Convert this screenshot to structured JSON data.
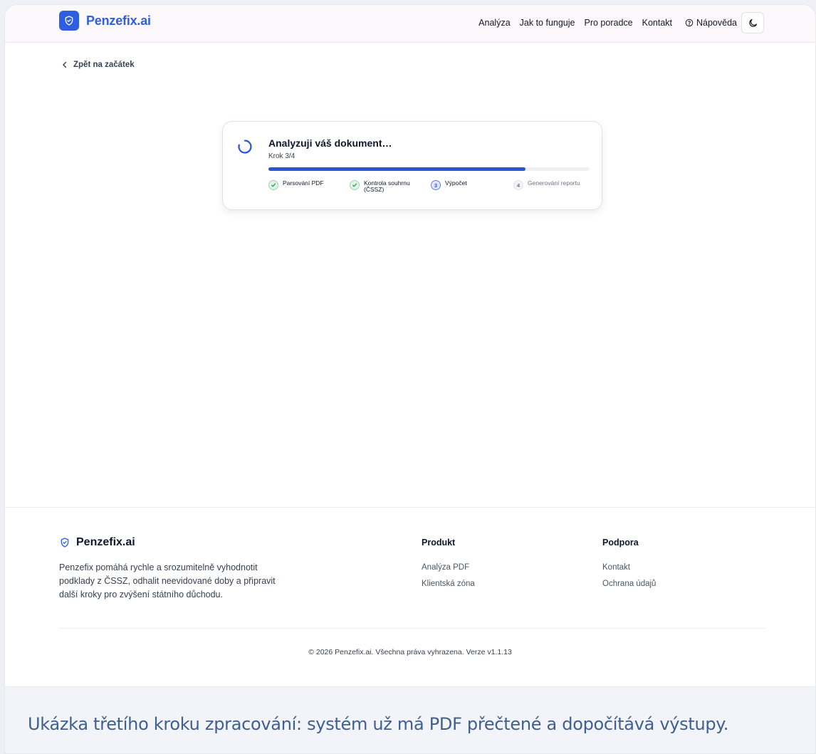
{
  "header": {
    "brand": "Penzefix.ai",
    "nav": [
      "Analýza",
      "Jak to funguje",
      "Pro poradce",
      "Kontakt"
    ],
    "help_label": "Nápověda",
    "theme_icon": "moon-icon"
  },
  "back_link": "Zpět na začátek",
  "progress": {
    "title": "Analyzuji váš dokument…",
    "step_label": "Krok 3/4",
    "fraction": 0.8,
    "steps": [
      {
        "label": "Parsování PDF",
        "status": "done"
      },
      {
        "label": "Kontrola souhrnu (ČSSZ)",
        "status": "done"
      },
      {
        "label": "Výpočet",
        "number": "3",
        "status": "active"
      },
      {
        "label": "Generování reportu",
        "number": "4",
        "status": "pending"
      }
    ]
  },
  "footer": {
    "brand": "Penzefix.ai",
    "description": "Penzefix pomáhá rychle a srozumitelně vyhodnotit podklady z ČSSZ, odhalit neevidované doby a připravit další kroky pro zvýšení státního důchodu.",
    "product_title": "Produkt",
    "product_links": [
      "Analýza PDF",
      "Klientská zóna"
    ],
    "support_title": "Podpora",
    "support_links": [
      "Kontakt",
      "Ochrana údajů"
    ],
    "copyright": "© 2026 Penzefix.ai. Všechna práva vyhrazena. Verze v1.1.13"
  },
  "caption": "Ukázka třetího kroku zpracování: systém už má PDF přečtené a dopočítává výstupy.",
  "colors": {
    "accent": "#2f5fe0",
    "progress_fill": "#2955d9",
    "done": "#22a04b",
    "caption": "#3e5f92"
  }
}
